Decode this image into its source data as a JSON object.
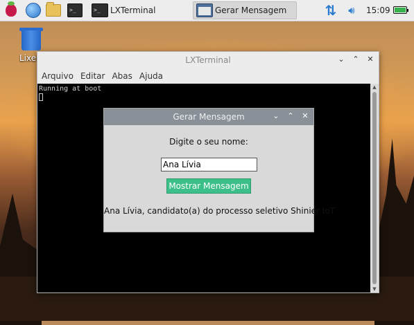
{
  "taskbar": {
    "apps": [
      {
        "name": "raspberry-menu",
        "icon": "raspberry-icon"
      },
      {
        "name": "browser",
        "icon": "globe-icon"
      },
      {
        "name": "file-manager",
        "icon": "folder-icon"
      },
      {
        "name": "terminal",
        "icon": "terminal-icon"
      }
    ],
    "tasks": [
      {
        "label": "LXTerminal",
        "icon": "terminal-icon"
      },
      {
        "label": "Gerar Mensagem",
        "icon": "window-icon",
        "active": true
      }
    ],
    "clock": "15:09",
    "tray": {
      "network_icon": "network-arrows-icon",
      "volume_icon": "speaker-icon",
      "battery_icon": "battery-icon",
      "battery_level": 1.0
    }
  },
  "desktop": {
    "trash_label": "Lixeira",
    "trash_icon": "trash-icon"
  },
  "terminal_window": {
    "title": "LXTerminal",
    "menu": [
      "Arquivo",
      "Editar",
      "Abas",
      "Ajuda"
    ],
    "output_line": "Running at boot",
    "controls": {
      "minimize": "⌄",
      "maximize": "⌃",
      "close": "✕"
    }
  },
  "dialog": {
    "title": "Gerar Mensagem",
    "prompt": "Digite o seu nome:",
    "name_value": "Ana Lívia",
    "button_label": "Mostrar Mensagem",
    "message": "Ana Lívia, candidato(a) do processo seletivo Shinier IoT",
    "controls": {
      "minimize": "⌄",
      "maximize": "⌃",
      "close": "✕"
    }
  },
  "colors": {
    "button_bg": "#3dbf8a",
    "dialog_title_bg": "#8a9098",
    "accent_blue": "#2a7bd0"
  }
}
